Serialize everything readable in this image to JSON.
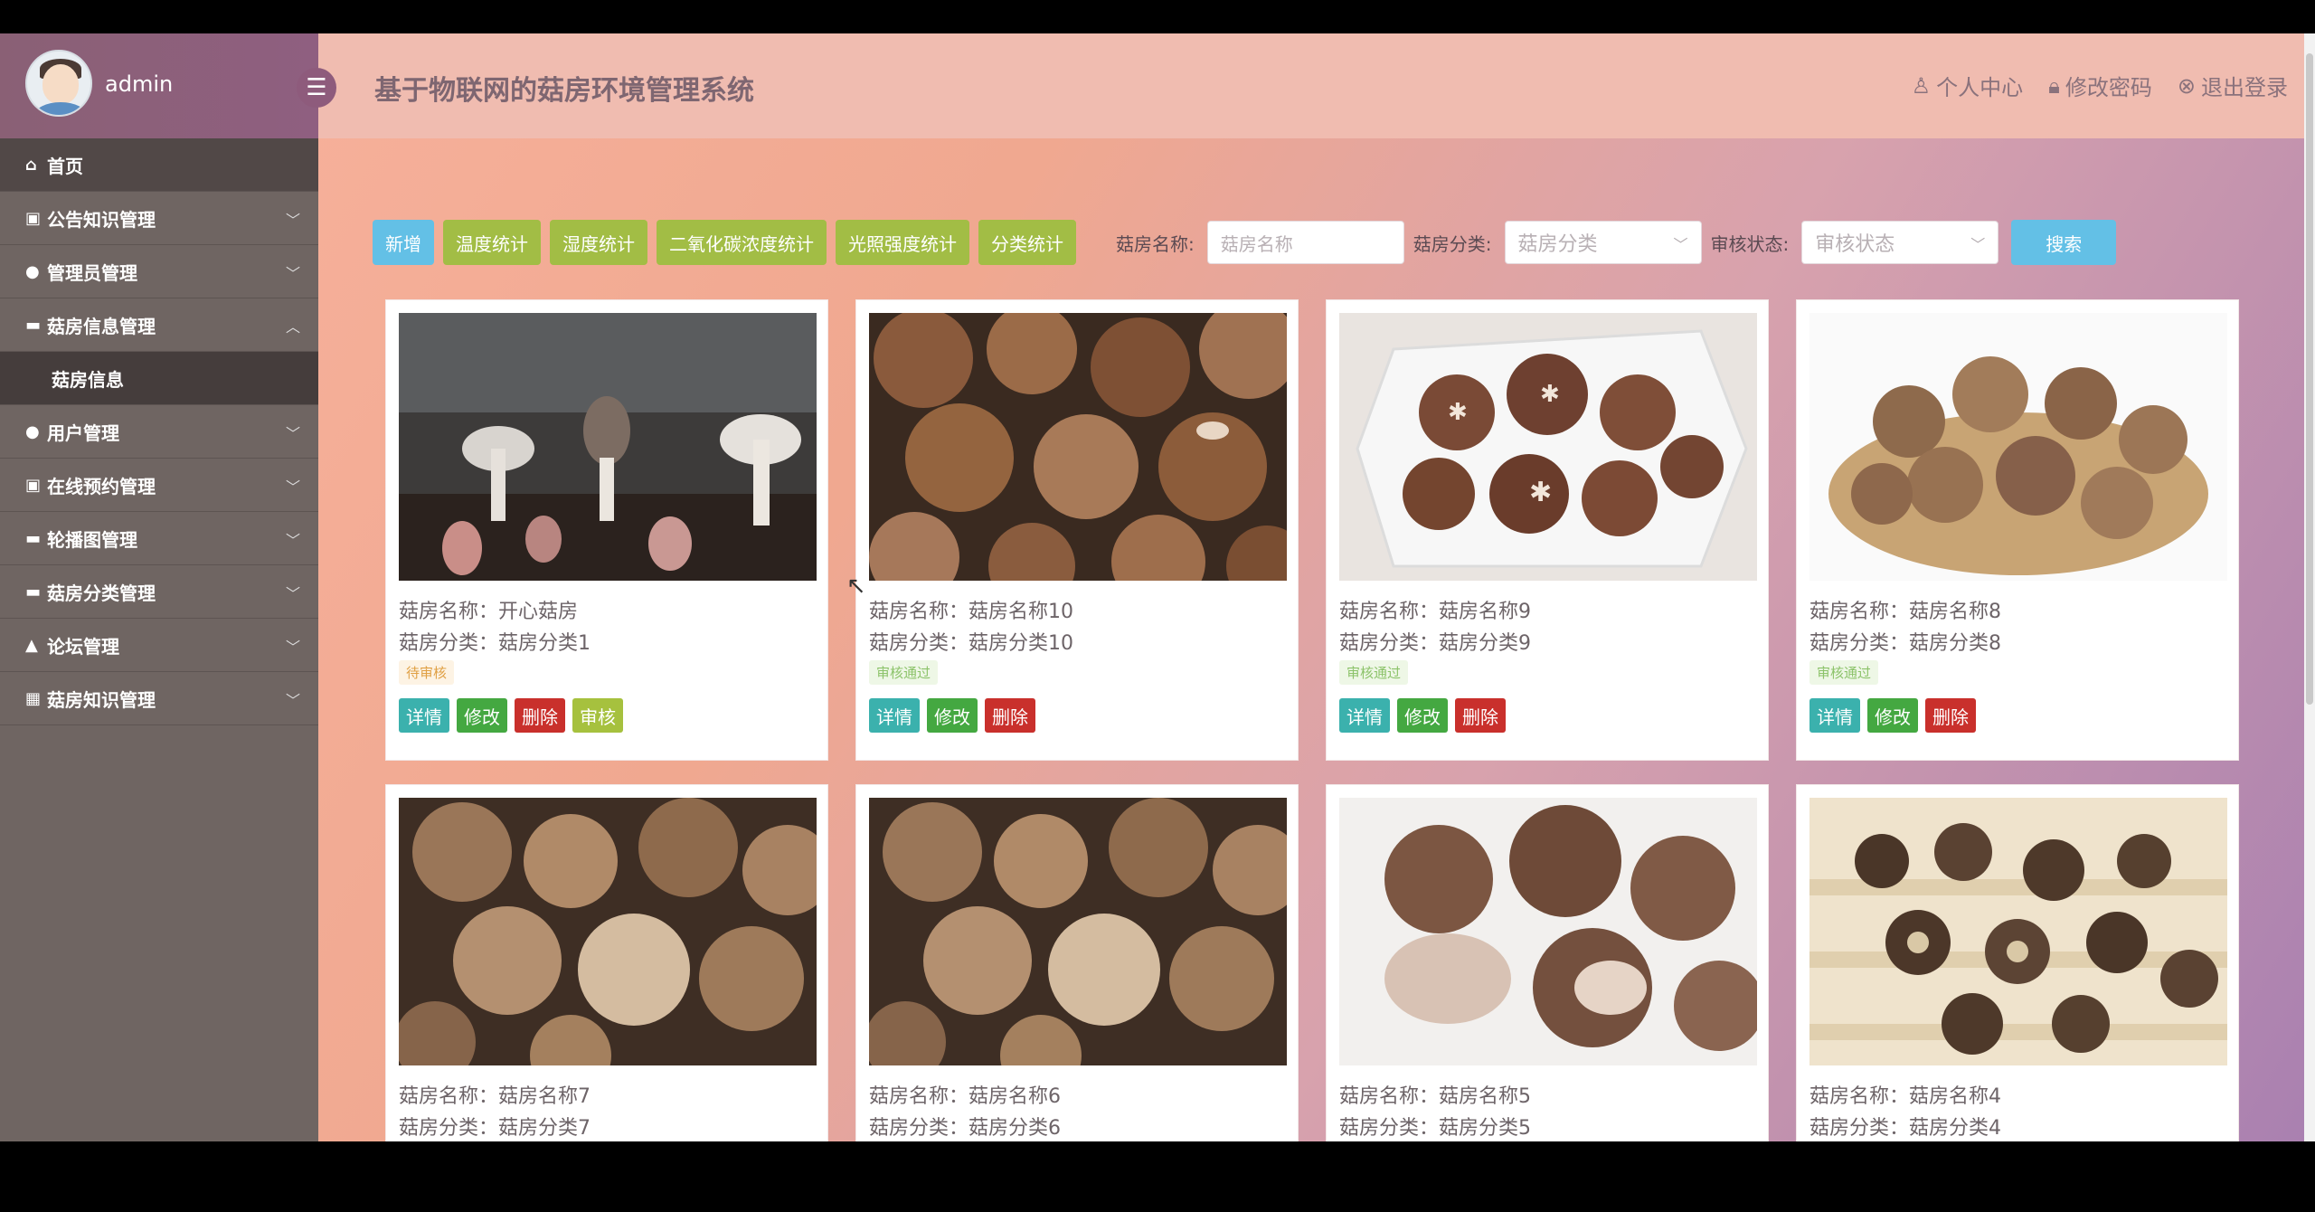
{
  "user": {
    "name": "admin"
  },
  "app": {
    "title": "基于物联网的菇房环境管理系统"
  },
  "header": {
    "links": [
      {
        "label": "个人中心",
        "icon": "user-icon"
      },
      {
        "label": "修改密码",
        "icon": "lock-icon"
      },
      {
        "label": "退出登录",
        "icon": "logout-icon"
      }
    ]
  },
  "sidebar": {
    "items": [
      {
        "label": "首页"
      },
      {
        "label": "公告知识管理"
      },
      {
        "label": "管理员管理"
      },
      {
        "label": "菇房信息管理",
        "expanded": true,
        "children": [
          {
            "label": "菇房信息"
          }
        ]
      },
      {
        "label": "用户管理"
      },
      {
        "label": "在线预约管理"
      },
      {
        "label": "轮播图管理"
      },
      {
        "label": "菇房分类管理"
      },
      {
        "label": "论坛管理"
      },
      {
        "label": "菇房知识管理"
      }
    ]
  },
  "toolbar": {
    "buttons": [
      "新增",
      "温度统计",
      "湿度统计",
      "二氧化碳浓度统计",
      "光照强度统计",
      "分类统计"
    ],
    "filters": {
      "name_label": "菇房名称:",
      "name_placeholder": "菇房名称",
      "category_label": "菇房分类:",
      "category_value": "菇房分类",
      "status_label": "审核状态:",
      "status_value": "审核状态"
    },
    "search_label": "搜索"
  },
  "cards": [
    {
      "name_line": "菇房名称：开心菇房",
      "cat_line": "菇房分类：菇房分类1",
      "status": "待审核",
      "actions": [
        "详情",
        "修改",
        "删除",
        "审核"
      ]
    },
    {
      "name_line": "菇房名称：菇房名称10",
      "cat_line": "菇房分类：菇房分类10",
      "status": "审核通过",
      "actions": [
        "详情",
        "修改",
        "删除"
      ]
    },
    {
      "name_line": "菇房名称：菇房名称9",
      "cat_line": "菇房分类：菇房分类9",
      "status": "审核通过",
      "actions": [
        "详情",
        "修改",
        "删除"
      ]
    },
    {
      "name_line": "菇房名称：菇房名称8",
      "cat_line": "菇房分类：菇房分类8",
      "status": "审核通过",
      "actions": [
        "详情",
        "修改",
        "删除"
      ]
    },
    {
      "name_line": "菇房名称：菇房名称7",
      "cat_line": "菇房分类：菇房分类7"
    },
    {
      "name_line": "菇房名称：菇房名称6",
      "cat_line": "菇房分类：菇房分类6"
    },
    {
      "name_line": "菇房名称：菇房名称5",
      "cat_line": "菇房分类：菇房分类5"
    },
    {
      "name_line": "菇房名称：菇房名称4",
      "cat_line": "菇房分类：菇房分类4"
    }
  ],
  "colors": {
    "sidebar_bg": "#6f6562",
    "header_bg": "#f0bcb0",
    "btn_blue": "#63c0e6",
    "btn_olive": "#a2bd45"
  }
}
